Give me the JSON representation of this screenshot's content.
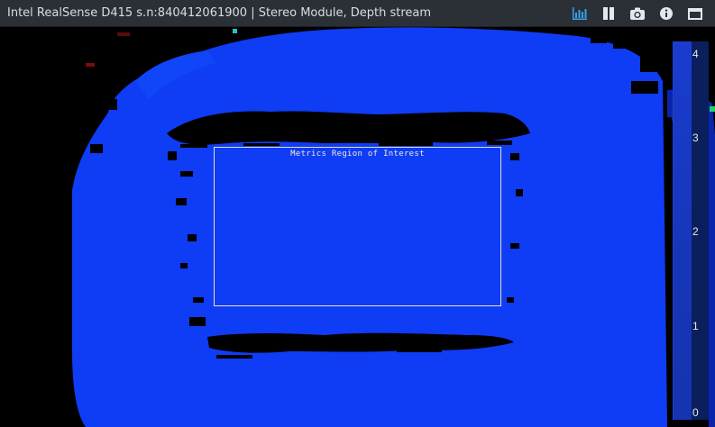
{
  "window": {
    "title": "Intel RealSense D415 s.n:840412061900 | Stereo Module, Depth stream"
  },
  "toolbar": {
    "icons": [
      "metrics-icon",
      "pause-icon",
      "camera-icon",
      "info-icon",
      "maximize-icon"
    ],
    "accent": "#3aa0f0"
  },
  "roi": {
    "label": "Metrics Region of Interest"
  },
  "scale": {
    "ticks": [
      "4",
      "3",
      "2",
      "1",
      "0"
    ]
  },
  "colors": {
    "depth_main": "#0f3cf5",
    "scale_bg": "#0a1f5c",
    "titlebar": "#2b3036"
  }
}
